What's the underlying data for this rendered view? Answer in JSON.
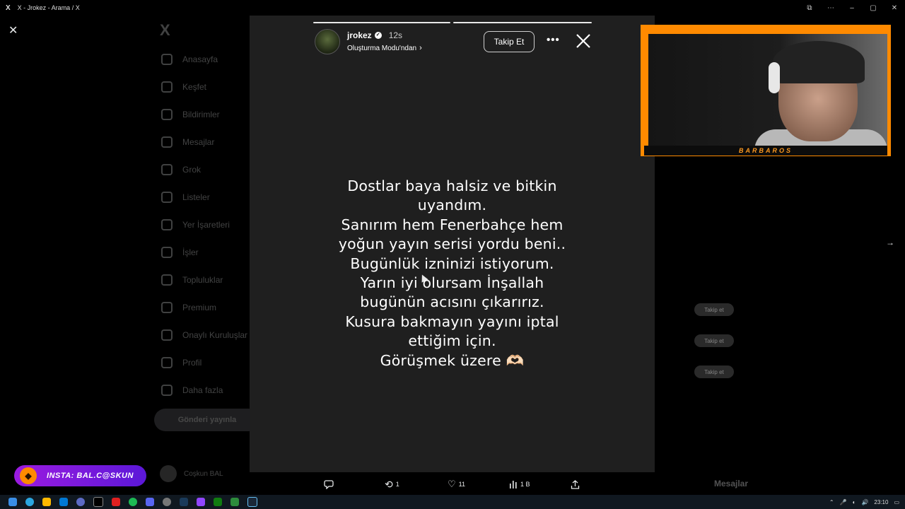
{
  "window": {
    "title": "X - Jrokez - Arama / X",
    "logo": "X"
  },
  "sidebar": {
    "logo": "X",
    "items": [
      {
        "label": "Anasayfa",
        "icon": "home-icon"
      },
      {
        "label": "Keşfet",
        "icon": "search-icon"
      },
      {
        "label": "Bildirimler",
        "icon": "bell-icon"
      },
      {
        "label": "Mesajlar",
        "icon": "mail-icon"
      },
      {
        "label": "Grok",
        "icon": "grok-icon"
      },
      {
        "label": "Listeler",
        "icon": "list-icon"
      },
      {
        "label": "Yer İşaretleri",
        "icon": "bookmark-icon"
      },
      {
        "label": "İşler",
        "icon": "briefcase-icon"
      },
      {
        "label": "Topluluklar",
        "icon": "people-icon"
      },
      {
        "label": "Premium",
        "icon": "x-icon"
      },
      {
        "label": "Onaylı Kuruluşlar",
        "icon": "lightning-icon"
      },
      {
        "label": "Profil",
        "icon": "user-icon"
      },
      {
        "label": "Daha fazla",
        "icon": "more-circle-icon"
      }
    ],
    "post_button": "Gönderi yayınla",
    "account_name": "Coşkun BAL"
  },
  "background_right": {
    "follow_labels": [
      "Takip et",
      "Takip et",
      "Takip et"
    ],
    "messages_label": "Mesajlar"
  },
  "story": {
    "username": "jrokez",
    "time": "12s",
    "subtitle": "Oluşturma Modu'ndan",
    "follow_button": "Takip Et",
    "more": "•••",
    "progress": {
      "segments": 2,
      "current": 2
    },
    "lines": [
      "Dostlar baya halsiz ve bitkin",
      "uyandım.",
      "Sanırım hem Fenerbahçe hem",
      "yoğun yayın serisi yordu beni..",
      "Bugünlük izninizi istiyorum.",
      "Yarın iyi olursam İnşallah",
      "bugünün acısını çıkarırız.",
      "Kusura bakmayın yayını iptal",
      "ettiğim için.",
      "Görüşmek üzere 🫶🏻"
    ]
  },
  "actions": {
    "reply": "",
    "repost": "1",
    "like": "11",
    "views": "1 B"
  },
  "webcam": {
    "banner": "BARBAROS"
  },
  "overlay": {
    "insta": "INSTA: BAL.C@SKUN"
  },
  "taskbar": {
    "time": "23:10"
  },
  "colors": {
    "story_bg": "#1f1f1f",
    "webcam_frame": "#ff8a00",
    "insta_badge": "#9b1be0"
  }
}
